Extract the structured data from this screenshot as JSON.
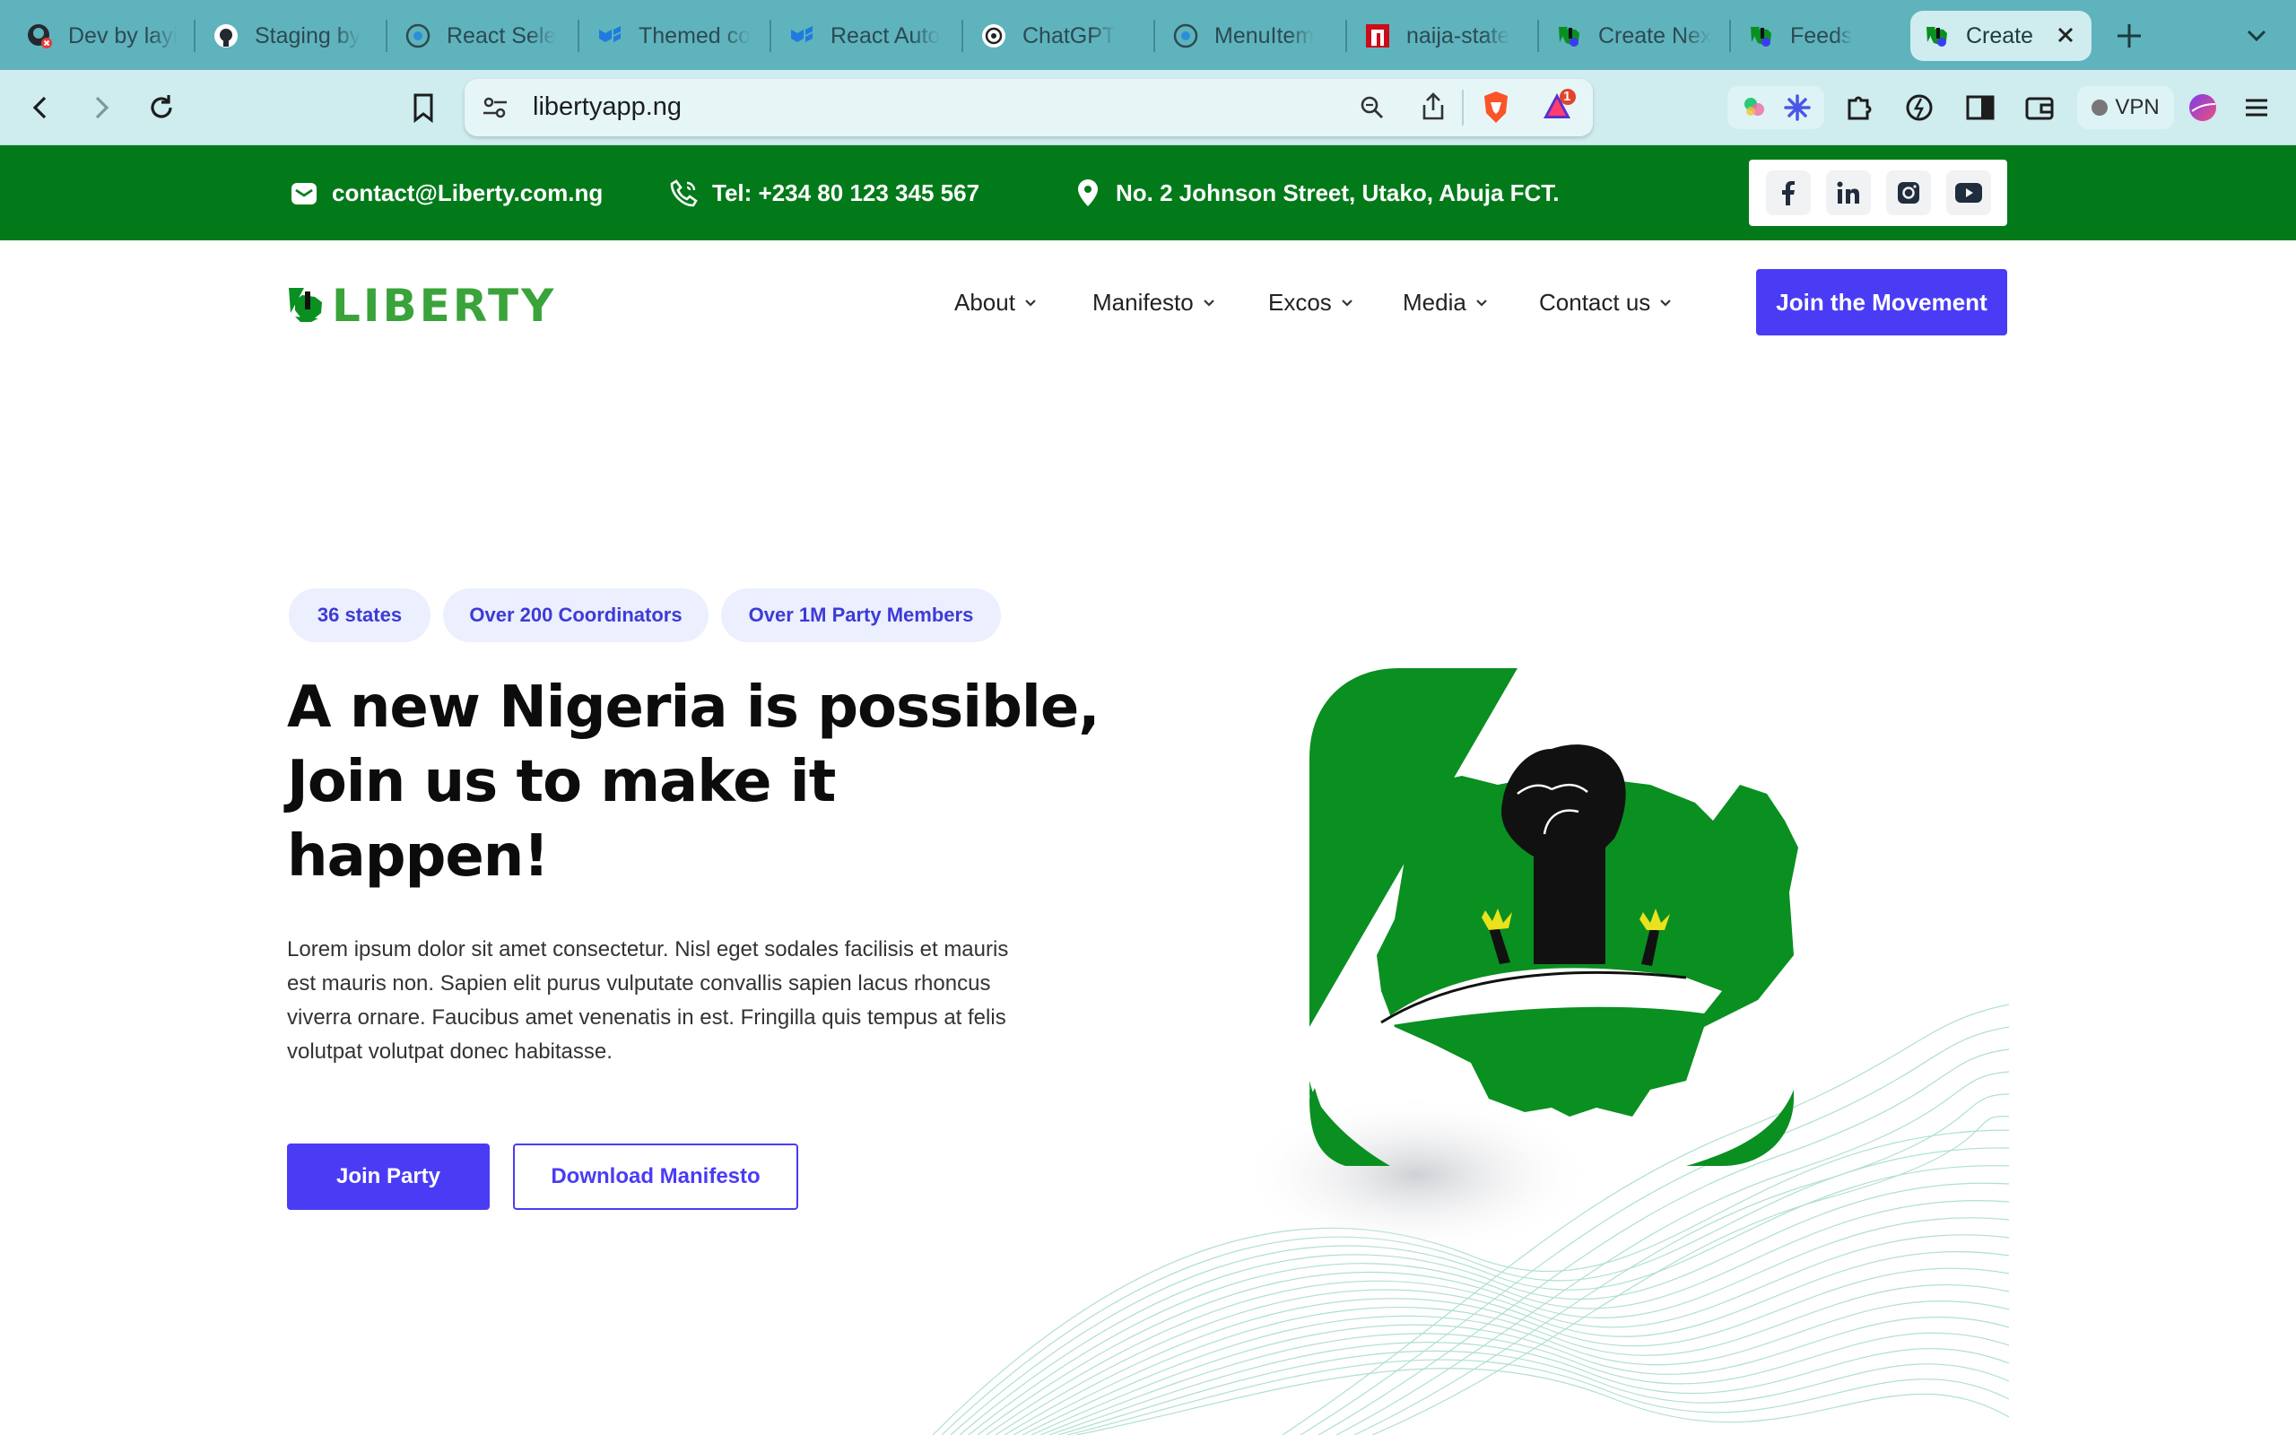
{
  "browser": {
    "tabs": [
      {
        "title": "Dev by layi",
        "icon": "github-warning-icon"
      },
      {
        "title": "Staging by",
        "icon": "github-icon"
      },
      {
        "title": "React Sele",
        "icon": "react-select-icon"
      },
      {
        "title": "Themed co",
        "icon": "mui-icon"
      },
      {
        "title": "React Auto",
        "icon": "mui-icon"
      },
      {
        "title": "ChatGPT",
        "icon": "chatgpt-icon"
      },
      {
        "title": "MenuItem",
        "icon": "react-select-icon"
      },
      {
        "title": "naija-state",
        "icon": "npm-icon"
      },
      {
        "title": "Create Nex",
        "icon": "liberty-icon"
      },
      {
        "title": "Feeds",
        "icon": "liberty-icon"
      },
      {
        "title": "Create",
        "icon": "liberty-icon",
        "active": true
      }
    ],
    "url": "libertyapp.ng",
    "brave_badge_count": "1",
    "vpn_label": "VPN"
  },
  "topbar": {
    "email": "contact@Liberty.com.ng",
    "phone": "Tel: +234 80 123 345 567",
    "address": "No. 2 Johnson Street, Utako, Abuja FCT.",
    "socials": [
      "facebook-icon",
      "linkedin-icon",
      "instagram-icon",
      "youtube-icon"
    ]
  },
  "nav": {
    "logo_text": "LIBERTY",
    "items": [
      "About",
      "Manifesto",
      "Excos",
      "Media",
      "Contact us"
    ],
    "cta": "Join the Movement"
  },
  "hero": {
    "chips": [
      "36 states",
      "Over 200 Coordinators",
      "Over 1M Party Members"
    ],
    "headline": [
      "A new Nigeria is possible,",
      "Join us to make it",
      "happen!"
    ],
    "body": "Lorem ipsum dolor sit amet consectetur. Nisl eget sodales facilisis et mauris est mauris non. Sapien elit purus vulputate convallis sapien lacus rhoncus viverra ornare. Faucibus amet venenatis in est. Fringilla quis tempus at felis volutpat volutpat donec habitasse.",
    "primary_button": "Join Party",
    "secondary_button": "Download Manifesto"
  },
  "colors": {
    "brand_green": "#037a1a",
    "logo_green": "#3aa33a",
    "accent_purple": "#4a3cf5",
    "chip_bg": "#eceffd",
    "tabbar": "#5fb3bd",
    "toolbar": "#cfecef"
  }
}
